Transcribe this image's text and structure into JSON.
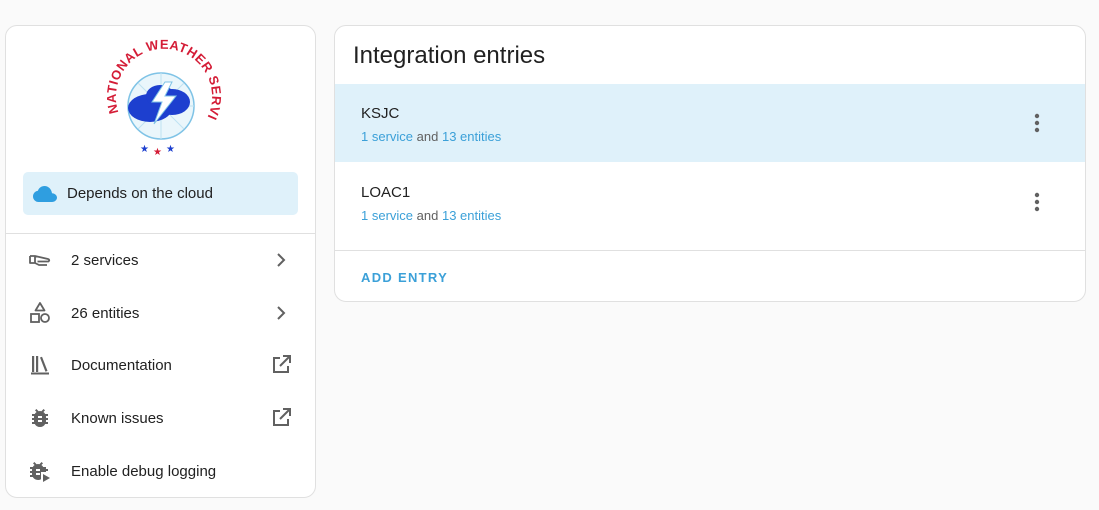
{
  "info": {
    "logo_text": "NATIONAL WEATHER SERVICE",
    "cloud_banner": {
      "icon": "cloud-icon",
      "label": "Depends on the cloud"
    },
    "menu": [
      {
        "icon": "service-icon",
        "label": "2 services",
        "trail": "chevron-right-icon"
      },
      {
        "icon": "entities-shapes-icon",
        "label": "26 entities",
        "trail": "chevron-right-icon"
      },
      {
        "icon": "book-shelf-icon",
        "label": "Documentation",
        "trail": "open-in-new-icon"
      },
      {
        "icon": "bug-icon",
        "label": "Known issues",
        "trail": "open-in-new-icon"
      },
      {
        "icon": "bug-play-icon",
        "label": "Enable debug logging",
        "trail": ""
      }
    ]
  },
  "entries": {
    "title": "Integration entries",
    "items": [
      {
        "name": "KSJC",
        "services": "1 service",
        "conjunction": "and",
        "entities": "13 entities",
        "selected": true
      },
      {
        "name": "LOAC1",
        "services": "1 service",
        "conjunction": "and",
        "entities": "13 entities",
        "selected": false
      }
    ],
    "add_label": "ADD ENTRY"
  },
  "colors": {
    "accent": "#3ba0d8",
    "selected_bg": "#dff1fa",
    "logo_red": "#d41c36",
    "logo_blue": "#1d3fcf"
  }
}
